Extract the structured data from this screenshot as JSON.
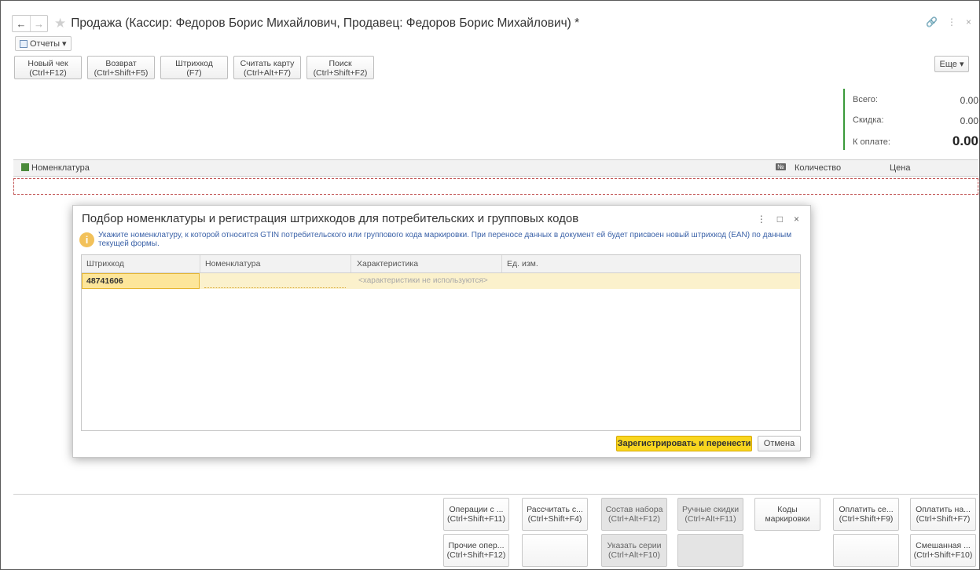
{
  "window": {
    "title": "Продажа (Кассир: Федоров Борис Михайлович, Продавец: Федоров Борис Михайлович) *",
    "back": "←",
    "forward": "→",
    "controls": [
      "🔗",
      "⋮",
      "×"
    ]
  },
  "reports": {
    "label": "Отчеты",
    "arrow": "▾"
  },
  "toolbar": [
    {
      "l1": "Новый чек",
      "l2": "(Ctrl+F12)"
    },
    {
      "l1": "Возврат",
      "l2": "(Ctrl+Shift+F5)"
    },
    {
      "l1": "Штрихкод",
      "l2": "(F7)"
    },
    {
      "l1": "Считать карту",
      "l2": "(Ctrl+Alt+F7)"
    },
    {
      "l1": "Поиск",
      "l2": "(Ctrl+Shift+F2)"
    }
  ],
  "more": {
    "label": "Еще",
    "arrow": "▾"
  },
  "totals": {
    "total_label": "Всего:",
    "total_value": "0.00",
    "discount_label": "Скидка:",
    "discount_value": "0.00",
    "pay_label": "К оплате:",
    "pay_value": "0.00"
  },
  "main_table": {
    "col_nomenclature": "Номенклатура",
    "num_badge": "№",
    "col_quantity": "Количество",
    "col_price": "Цена"
  },
  "modal": {
    "title": "Подбор номенклатуры и регистрация штрихкодов для потребительских и групповых кодов",
    "controls": [
      "⋮",
      "□",
      "×"
    ],
    "info_icon": "i",
    "info": "Укажите номенклатуру, к которой относится GTIN потребительского или группового кода маркировки. При переносе данных в документ ей будет присвоен новый штрихкод (EAN) по данным текущей формы.",
    "columns": [
      "Штрихкод",
      "Номенклатура",
      "Характеристика",
      "Ед. изм."
    ],
    "row": {
      "barcode": "48741606",
      "nomenclature": "",
      "characteristic": "<характеристики не используются>",
      "unit": ""
    },
    "ok_label": "Зарегистрировать и перенести",
    "cancel_label": "Отмена"
  },
  "bottom_buttons": [
    {
      "l1": "Операции с ...",
      "l2": "(Ctrl+Shift+F11)",
      "disabled": false
    },
    {
      "l1": "Рассчитать с...",
      "l2": "(Ctrl+Shift+F4)",
      "disabled": false
    },
    {
      "l1": "Состав набора",
      "l2": "(Ctrl+Alt+F12)",
      "disabled": true
    },
    {
      "l1": "Ручные скидки",
      "l2": "(Ctrl+Alt+F11)",
      "disabled": true
    },
    {
      "l1": "Коды",
      "l2": "маркировки",
      "disabled": false
    },
    {
      "l1": "Оплатить се...",
      "l2": "(Ctrl+Shift+F9)",
      "disabled": false
    },
    {
      "l1": "Оплатить на...",
      "l2": "(Ctrl+Shift+F7)",
      "disabled": false
    },
    {
      "l1": "Прочие опер...",
      "l2": "(Ctrl+Shift+F12)",
      "disabled": false
    },
    {
      "l1": "",
      "l2": "",
      "disabled": false
    },
    {
      "l1": "Указать серии",
      "l2": "(Ctrl+Alt+F10)",
      "disabled": true
    },
    {
      "l1": "",
      "l2": "",
      "disabled": true
    },
    {
      "l1": "",
      "l2": "",
      "disabled": false
    },
    {
      "l1": "Смешанная ...",
      "l2": "(Ctrl+Shift+F10)",
      "disabled": false
    }
  ]
}
